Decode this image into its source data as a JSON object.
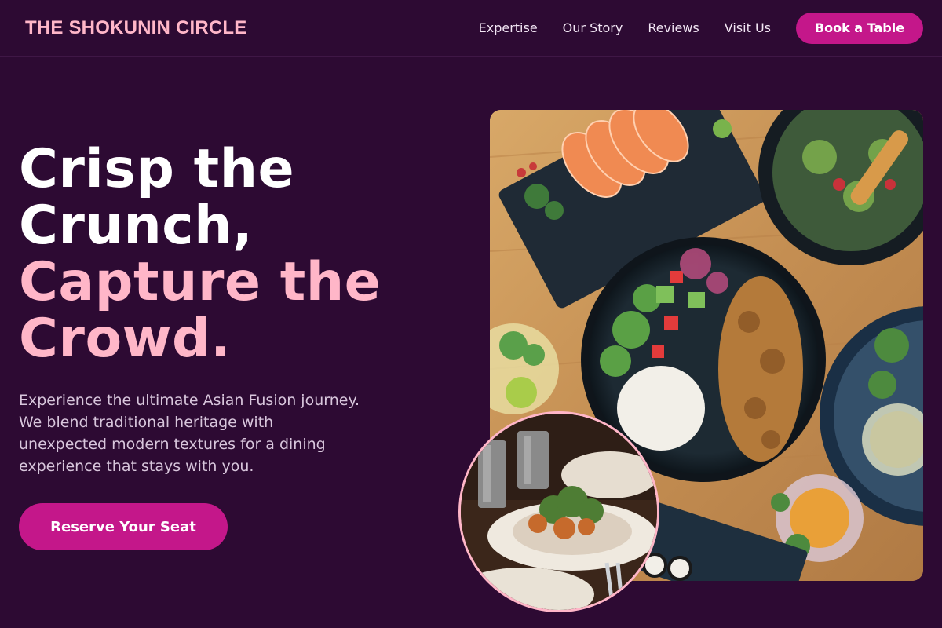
{
  "brand": {
    "name": "THE SHOKUNIN CIRCLE"
  },
  "nav": {
    "links": [
      "Expertise",
      "Our Story",
      "Reviews",
      "Visit Us"
    ],
    "cta": "Book a Table"
  },
  "hero": {
    "headline_line1": "Crisp the",
    "headline_line2": "Crunch,",
    "headline_accent1": "Capture the",
    "headline_accent2": "Crowd.",
    "subtitle": "Experience the ultimate Asian Fusion journey. We blend traditional heritage with unexpected modern textures for a dining experience that stays with you.",
    "cta": "Reserve Your Seat"
  },
  "colors": {
    "background": "#2d0a33",
    "brand_pink": "#ffb6c8",
    "button_magenta": "#c4178a",
    "body_text": "#d8c6dc"
  }
}
